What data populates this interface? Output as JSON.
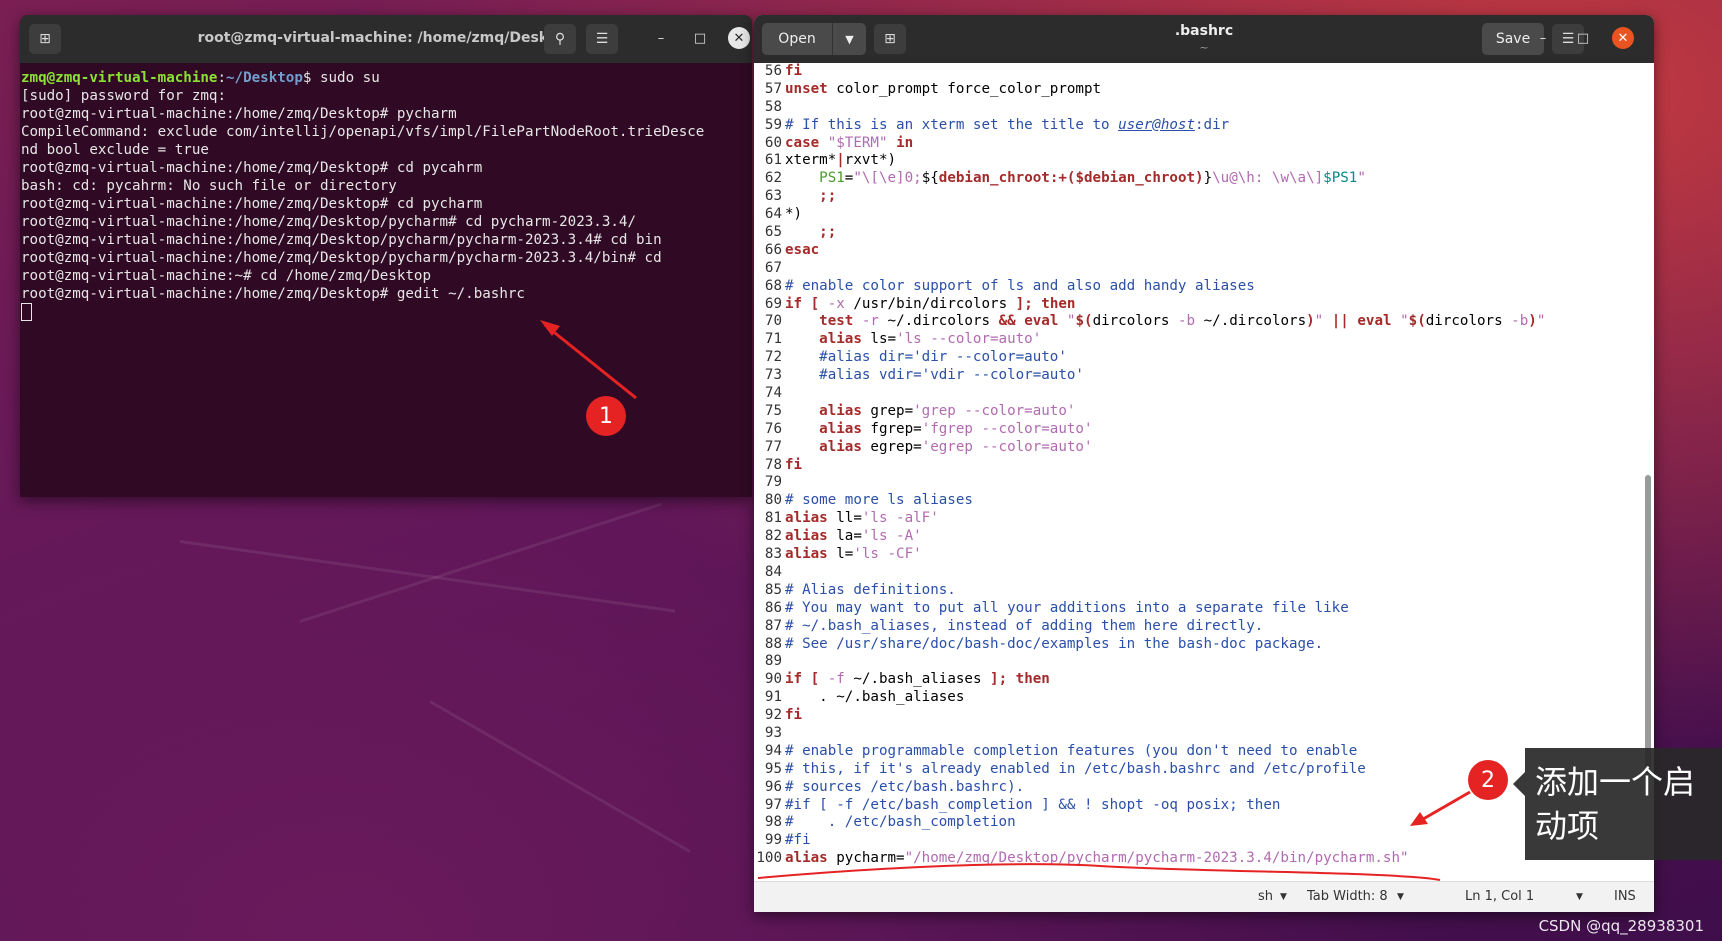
{
  "terminal": {
    "title": "root@zmq-virtual-machine: /home/zmq/Desktop",
    "prompt_user": "zmq@zmq-virtual-machine",
    "prompt_path": "~/Desktop",
    "first_command": " sudo su",
    "lines": [
      "[sudo] password for zmq:",
      "root@zmq-virtual-machine:/home/zmq/Desktop# pycharm",
      "CompileCommand: exclude com/intellij/openapi/vfs/impl/FilePartNodeRoot.trieDesce",
      "nd bool exclude = true",
      "root@zmq-virtual-machine:/home/zmq/Desktop# cd pycahrm",
      "bash: cd: pycahrm: No such file or directory",
      "root@zmq-virtual-machine:/home/zmq/Desktop# cd pycharm",
      "root@zmq-virtual-machine:/home/zmq/Desktop/pycharm# cd pycharm-2023.3.4/",
      "root@zmq-virtual-machine:/home/zmq/Desktop/pycharm/pycharm-2023.3.4# cd bin",
      "root@zmq-virtual-machine:/home/zmq/Desktop/pycharm/pycharm-2023.3.4/bin# cd",
      "root@zmq-virtual-machine:~# cd /home/zmq/Desktop",
      "root@zmq-virtual-machine:/home/zmq/Desktop# gedit ~/.bashrc"
    ]
  },
  "editor": {
    "open_label": "Open",
    "save_label": "Save",
    "title": ".bashrc",
    "subtitle": "~",
    "status": {
      "language": "sh",
      "tab_width": "Tab Width: 8",
      "position": "Ln 1, Col 1",
      "mode": "INS"
    },
    "code_lines": [
      {
        "n": "56",
        "segs": [
          [
            "kw",
            "fi"
          ]
        ]
      },
      {
        "n": "57",
        "segs": [
          [
            "kw",
            "unset"
          ],
          [
            "ct",
            " color_prompt force_color_prompt"
          ]
        ]
      },
      {
        "n": "58",
        "segs": []
      },
      {
        "n": "59",
        "segs": [
          [
            "cm",
            "# If this is an xterm set the title to "
          ],
          [
            "url",
            "user@host"
          ],
          [
            "cm",
            ":dir"
          ]
        ]
      },
      {
        "n": "60",
        "segs": [
          [
            "kw",
            "case"
          ],
          [
            "ct",
            " "
          ],
          [
            "st",
            "\"$TERM\""
          ],
          [
            "ct",
            " "
          ],
          [
            "kw",
            "in"
          ]
        ]
      },
      {
        "n": "61",
        "segs": [
          [
            "ct",
            "xterm*"
          ],
          [
            "kw",
            "|"
          ],
          [
            "ct",
            "rxvt*)"
          ]
        ]
      },
      {
        "n": "62",
        "segs": [
          [
            "ct",
            "    "
          ],
          [
            "gr",
            "PS1"
          ],
          [
            "ct",
            "="
          ],
          [
            "st",
            "\"\\[\\e]0;"
          ],
          [
            "ct",
            "${"
          ],
          [
            "kw",
            "debian_chroot:+($debian_chroot)"
          ],
          [
            "ct",
            "}"
          ],
          [
            "st",
            "\\u@\\h: \\w\\a\\]"
          ],
          [
            "vr",
            "$PS1"
          ],
          [
            "st",
            "\""
          ]
        ]
      },
      {
        "n": "63",
        "segs": [
          [
            "ct",
            "    "
          ],
          [
            "kw",
            ";;"
          ]
        ]
      },
      {
        "n": "64",
        "segs": [
          [
            "ct",
            "*)"
          ]
        ]
      },
      {
        "n": "65",
        "segs": [
          [
            "ct",
            "    "
          ],
          [
            "kw",
            ";;"
          ]
        ]
      },
      {
        "n": "66",
        "segs": [
          [
            "kw",
            "esac"
          ]
        ]
      },
      {
        "n": "67",
        "segs": []
      },
      {
        "n": "68",
        "segs": [
          [
            "cm",
            "# enable color support of ls and also add handy aliases"
          ]
        ]
      },
      {
        "n": "69",
        "segs": [
          [
            "kw",
            "if"
          ],
          [
            "ct",
            " "
          ],
          [
            "kw",
            "["
          ],
          [
            "ct",
            " "
          ],
          [
            "st",
            "-x"
          ],
          [
            "ct",
            " /usr/bin/dircolors "
          ],
          [
            "kw",
            "]; then"
          ]
        ]
      },
      {
        "n": "70",
        "segs": [
          [
            "ct",
            "    "
          ],
          [
            "kw",
            "test"
          ],
          [
            "ct",
            " "
          ],
          [
            "st",
            "-r"
          ],
          [
            "ct",
            " ~/.dircolors "
          ],
          [
            "kw",
            "&& eval"
          ],
          [
            "ct",
            " "
          ],
          [
            "st",
            "\""
          ],
          [
            "kw",
            "$("
          ],
          [
            "ct",
            "dircolors "
          ],
          [
            "st",
            "-b"
          ],
          [
            "ct",
            " ~/.dircolors"
          ],
          [
            "kw",
            ")"
          ],
          [
            "st",
            "\""
          ],
          [
            "ct",
            " "
          ],
          [
            "kw",
            "|| eval"
          ],
          [
            "ct",
            " "
          ],
          [
            "st",
            "\""
          ],
          [
            "kw",
            "$("
          ],
          [
            "ct",
            "dircolors "
          ],
          [
            "st",
            "-b"
          ],
          [
            "kw",
            ")"
          ],
          [
            "st",
            "\""
          ]
        ]
      },
      {
        "n": "71",
        "segs": [
          [
            "ct",
            "    "
          ],
          [
            "kw",
            "alias"
          ],
          [
            "ct",
            " ls="
          ],
          [
            "st",
            "'ls --color=auto'"
          ]
        ]
      },
      {
        "n": "72",
        "segs": [
          [
            "ct",
            "    "
          ],
          [
            "cm",
            "#alias dir='dir --color=auto'"
          ]
        ]
      },
      {
        "n": "73",
        "segs": [
          [
            "ct",
            "    "
          ],
          [
            "cm",
            "#alias vdir='vdir --color=auto'"
          ]
        ]
      },
      {
        "n": "74",
        "segs": []
      },
      {
        "n": "75",
        "segs": [
          [
            "ct",
            "    "
          ],
          [
            "kw",
            "alias"
          ],
          [
            "ct",
            " grep="
          ],
          [
            "st",
            "'grep --color=auto'"
          ]
        ]
      },
      {
        "n": "76",
        "segs": [
          [
            "ct",
            "    "
          ],
          [
            "kw",
            "alias"
          ],
          [
            "ct",
            " fgrep="
          ],
          [
            "st",
            "'fgrep --color=auto'"
          ]
        ]
      },
      {
        "n": "77",
        "segs": [
          [
            "ct",
            "    "
          ],
          [
            "kw",
            "alias"
          ],
          [
            "ct",
            " egrep="
          ],
          [
            "st",
            "'egrep --color=auto'"
          ]
        ]
      },
      {
        "n": "78",
        "segs": [
          [
            "kw",
            "fi"
          ]
        ]
      },
      {
        "n": "79",
        "segs": []
      },
      {
        "n": "80",
        "segs": [
          [
            "cm",
            "# some more ls aliases"
          ]
        ]
      },
      {
        "n": "81",
        "segs": [
          [
            "kw",
            "alias"
          ],
          [
            "ct",
            " ll="
          ],
          [
            "st",
            "'ls -alF'"
          ]
        ]
      },
      {
        "n": "82",
        "segs": [
          [
            "kw",
            "alias"
          ],
          [
            "ct",
            " la="
          ],
          [
            "st",
            "'ls -A'"
          ]
        ]
      },
      {
        "n": "83",
        "segs": [
          [
            "kw",
            "alias"
          ],
          [
            "ct",
            " l="
          ],
          [
            "st",
            "'ls -CF'"
          ]
        ]
      },
      {
        "n": "84",
        "segs": []
      },
      {
        "n": "85",
        "segs": [
          [
            "cm",
            "# Alias definitions."
          ]
        ]
      },
      {
        "n": "86",
        "segs": [
          [
            "cm",
            "# You may want to put all your additions into a separate file like"
          ]
        ]
      },
      {
        "n": "87",
        "segs": [
          [
            "cm",
            "# ~/.bash_aliases, instead of adding them here directly."
          ]
        ]
      },
      {
        "n": "88",
        "segs": [
          [
            "cm",
            "# See /usr/share/doc/bash-doc/examples in the bash-doc package."
          ]
        ]
      },
      {
        "n": "89",
        "segs": []
      },
      {
        "n": "90",
        "segs": [
          [
            "kw",
            "if"
          ],
          [
            "ct",
            " "
          ],
          [
            "kw",
            "["
          ],
          [
            "ct",
            " "
          ],
          [
            "st",
            "-f"
          ],
          [
            "ct",
            " ~/.bash_aliases "
          ],
          [
            "kw",
            "]; then"
          ]
        ]
      },
      {
        "n": "91",
        "segs": [
          [
            "ct",
            "    . ~/.bash_aliases"
          ]
        ]
      },
      {
        "n": "92",
        "segs": [
          [
            "kw",
            "fi"
          ]
        ]
      },
      {
        "n": "93",
        "segs": []
      },
      {
        "n": "94",
        "segs": [
          [
            "cm",
            "# enable programmable completion features (you don't need to enable"
          ]
        ]
      },
      {
        "n": "95",
        "segs": [
          [
            "cm",
            "# this, if it's already enabled in /etc/bash.bashrc and /etc/profile"
          ]
        ]
      },
      {
        "n": "96",
        "segs": [
          [
            "cm",
            "# sources /etc/bash.bashrc)."
          ]
        ]
      },
      {
        "n": "97",
        "segs": [
          [
            "cm",
            "#if [ -f /etc/bash_completion ] && ! shopt -oq posix; then"
          ]
        ]
      },
      {
        "n": "98",
        "segs": [
          [
            "cm",
            "#    . /etc/bash_completion"
          ]
        ]
      },
      {
        "n": "99",
        "segs": [
          [
            "cm",
            "#fi"
          ]
        ]
      },
      {
        "n": "100",
        "segs": [
          [
            "kw",
            "alias"
          ],
          [
            "ct",
            " pycharm="
          ],
          [
            "st",
            "\"/home/zmq/Desktop/pycharm/pycharm-2023.3.4/bin/pycharm.sh\""
          ]
        ]
      }
    ]
  },
  "annotations": {
    "badge_1": "1",
    "badge_2": "2",
    "callout_text": "添加一个启动项",
    "accent_color": "#e52323"
  },
  "watermark": "CSDN @qq_28938301"
}
